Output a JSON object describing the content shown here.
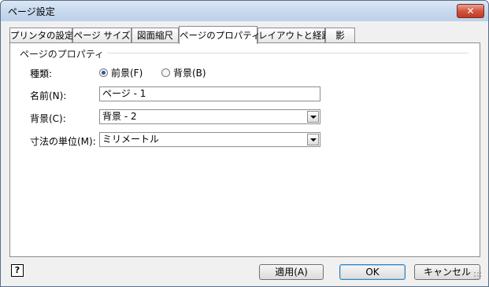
{
  "window": {
    "title": "ページ設定",
    "close_icon": "close-icon"
  },
  "tabs": [
    {
      "label": "プリンタの設定"
    },
    {
      "label": "ページ サイズ"
    },
    {
      "label": "図面縮尺"
    },
    {
      "label": "ページのプロパティ",
      "active": true
    },
    {
      "label": "レイアウトと経路"
    },
    {
      "label": "影"
    }
  ],
  "page_properties": {
    "group_title": "ページのプロパティ",
    "type_label": "種類:",
    "type_options": [
      {
        "label": "前景(F)",
        "checked": true
      },
      {
        "label": "背景(B)",
        "checked": false
      }
    ],
    "name_label": "名前(N):",
    "name_value": "ページ - 1",
    "background_label": "背景(C):",
    "background_value": "背景 - 2",
    "units_label": "寸法の単位(M):",
    "units_value": "ミリメートル"
  },
  "footer": {
    "help_icon": "help-icon",
    "apply_label": "適用(A)",
    "ok_label": "OK",
    "cancel_label": "キャンセル"
  },
  "colors": {
    "titlebar": "#c7d8ee",
    "close_button": "#c13a22",
    "default_button_border": "#3c7fb1",
    "radio_dot": "#2a5aa0"
  }
}
